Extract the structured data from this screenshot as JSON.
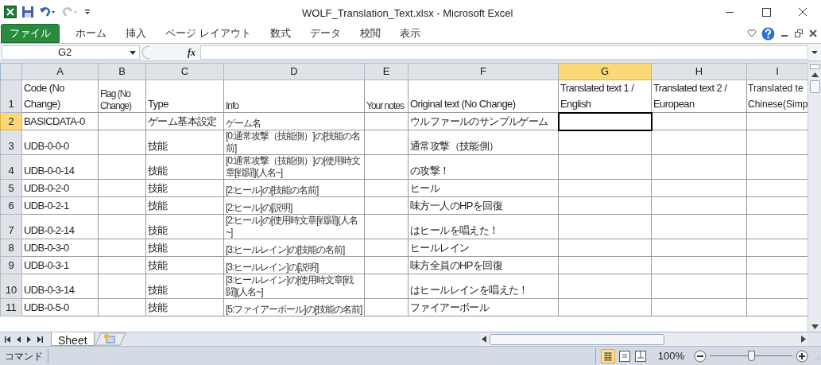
{
  "window": {
    "title": "WOLF_Translation_Text.xlsx - Microsoft Excel"
  },
  "ribbon_tabs": [
    {
      "label": "ファイル",
      "kind": "file"
    },
    {
      "label": "ホーム",
      "kind": "tab"
    },
    {
      "label": "挿入",
      "kind": "tab"
    },
    {
      "label": "ページ レイアウト",
      "kind": "tab"
    },
    {
      "label": "数式",
      "kind": "tab"
    },
    {
      "label": "データ",
      "kind": "tab"
    },
    {
      "label": "校閲",
      "kind": "tab"
    },
    {
      "label": "表示",
      "kind": "tab"
    }
  ],
  "formula_bar": {
    "name_box": "G2",
    "fx": "fx"
  },
  "columns": [
    {
      "letter": "A",
      "kind": "normal",
      "selected": false
    },
    {
      "letter": "B",
      "kind": "note",
      "selected": false
    },
    {
      "letter": "C",
      "kind": "normal",
      "selected": false
    },
    {
      "letter": "D",
      "kind": "note",
      "selected": false
    },
    {
      "letter": "E",
      "kind": "note",
      "selected": false
    },
    {
      "letter": "F",
      "kind": "normal",
      "selected": false
    },
    {
      "letter": "G",
      "kind": "normal",
      "selected": true
    },
    {
      "letter": "H",
      "kind": "normal",
      "selected": false
    },
    {
      "letter": "I",
      "kind": "partial",
      "selected": false
    }
  ],
  "rows": [
    {
      "number": "1",
      "selected": false,
      "cells": {
        "A": "Code (No Change)",
        "B": "Flag (No Change)",
        "C": "Type",
        "D": "Info",
        "E": "Your notes",
        "F": "Original text (No Change)",
        "G": "Translated text 1 / English",
        "H": "Translated text 2 / European",
        "I": "Translated te\nChinese(Simp"
      }
    },
    {
      "number": "2",
      "selected": true,
      "cells": {
        "A": "BASICDATA-0",
        "C": "ゲーム基本設定",
        "D": "ゲーム名",
        "F": "ウルファールのサンプルゲーム"
      }
    },
    {
      "number": "3",
      "selected": false,
      "cells": {
        "A": "UDB-0-0-0",
        "C": "技能",
        "D": "[0:通常攻撃（技能側）]の[技能の名前]",
        "F": "通常攻撃（技能側）"
      }
    },
    {
      "number": "4",
      "selected": false,
      "cells": {
        "A": "UDB-0-0-14",
        "C": "技能",
        "D": "[0:通常攻撃（技能側）]の[使用時文章[戦闘](人名~]",
        "F": "の攻撃！"
      }
    },
    {
      "number": "5",
      "selected": false,
      "cells": {
        "A": "UDB-0-2-0",
        "C": "技能",
        "D": "[2:ヒール]の[技能の名前]",
        "F": "ヒール"
      }
    },
    {
      "number": "6",
      "selected": false,
      "cells": {
        "A": "UDB-0-2-1",
        "C": "技能",
        "D": "[2:ヒール]の[説明]",
        "F": "味方一人のHPを回復"
      }
    },
    {
      "number": "7",
      "selected": false,
      "cells": {
        "A": "UDB-0-2-14",
        "C": "技能",
        "D": "[2:ヒール]の[使用時文章[戦闘](人名~]",
        "F": "はヒールを唱えた！"
      }
    },
    {
      "number": "8",
      "selected": false,
      "cells": {
        "A": "UDB-0-3-0",
        "C": "技能",
        "D": "[3:ヒールレイン]の[技能の名前]",
        "F": "ヒールレイン"
      }
    },
    {
      "number": "9",
      "selected": false,
      "cells": {
        "A": "UDB-0-3-1",
        "C": "技能",
        "D": "[3:ヒールレイン]の[説明]",
        "F": "味方全員のHPを回復"
      }
    },
    {
      "number": "10",
      "selected": false,
      "cells": {
        "A": "UDB-0-3-14",
        "C": "技能",
        "D": "[3:ヒールレイン]の[使用時文章[戦闘](人名~]",
        "F": "はヒールレインを唱えた！"
      }
    },
    {
      "number": "11",
      "selected": false,
      "cells": {
        "A": "UDB-0-5-0",
        "C": "技能",
        "D": "[5:ファイアーボール]の[技能の名前]",
        "F": "ファイアーボール"
      }
    }
  ],
  "sheet_tabs": [
    {
      "label": "Sheet",
      "selected": true
    }
  ],
  "status_bar": {
    "mode": "コマンド",
    "zoom": "100%",
    "zoom_level": {
      "level": 0.5
    }
  }
}
